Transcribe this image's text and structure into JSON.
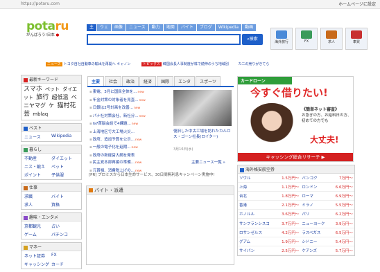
{
  "topbar": {
    "url": "https://potaru.com",
    "home_link": "ホームページに設定"
  },
  "logo": {
    "name_a": "pota",
    "name_b": "ru",
    "tagline": "がんばろう!日本"
  },
  "nav": {
    "tabs": [
      "主",
      "ウェ",
      "画像",
      "ニュース",
      "動力",
      "地図",
      "バイト",
      "ブログ",
      "Wikipedia",
      "動画"
    ],
    "search_button": "検索"
  },
  "quick": [
    "海外旅行",
    "FX",
    "求人",
    "車買"
  ],
  "ticker": {
    "tag1": "ニュース",
    "text1": "トヨタ自社自動車の輸出を再開へ キャノン",
    "tag2": "トピックス",
    "text2": "韓国会長人事制度が株で続伸のうち地域別",
    "text3": "カ二の売りがきてら"
  },
  "left": {
    "hot_header": "最新キーワード",
    "hot_keywords": [
      "スマホ",
      "ペット",
      "ダイエット",
      "旅行",
      "超低温",
      "ベニヤマグ",
      "ケ",
      "猫村花芸",
      "mblaq"
    ],
    "search_header": "ベスト",
    "search_links": [
      "ニュース",
      "Wikipedia"
    ],
    "life_header": "暮らし",
    "life_links": [
      "不動産",
      "ダイエット",
      "ニス・鍛え",
      "ペット",
      "ポイント",
      "子供服"
    ],
    "job_header": "仕事",
    "job_links": [
      "求職",
      "バイト",
      "求人",
      "資格"
    ],
    "hobby_header": "趣味・エンタメ",
    "hobby_links": [
      "京都観光",
      "占い",
      "ゲーム",
      "パチンコ"
    ],
    "money_header": "マネー",
    "money_links": [
      "ネット証券",
      "FX",
      "キャッシング",
      "カード"
    ]
  },
  "main": {
    "tabs": [
      "主要",
      "社会",
      "政治",
      "経済",
      "国際",
      "エンタ",
      "スポーツ"
    ],
    "headlines": [
      "東電、3月に国民全体を...",
      "年金対策の対象者を見直...",
      "日銀は2号計画を改善...",
      "パナ社対策会社、新社分...",
      "G7首脳会談で4課題...",
      "上海地区で大工場火災...",
      "政府、追加予算を公示...",
      "一般の電子化を延期...",
      "政府の新経営大綱を発表",
      "民主党本部再編の準備...",
      "元首相、消費税上げの..."
    ],
    "new_label": "new",
    "photo_caption": "復旧した中古工場を訪れたカルロス・ゴーン社長(ロイター)",
    "photo_date": "3月16日(水)",
    "more_news": "主要ニュース一覧 »"
  },
  "pr": "[PR] プロミスから日本生命サービス、30日間無利息キャンペーン実施中!",
  "baito": {
    "header": "バイト・派遣"
  },
  "ad": {
    "brand": "カードローン",
    "headline": "今すぐ借りたい!",
    "sub": "《簡単ネット審査》",
    "text": "お急ぎの方、お給料日の方、初めての方でも",
    "ok": "大丈夫!",
    "footer": "キャッシング総合リサーチ ▶"
  },
  "fx": {
    "header": "海外格安航空券",
    "rows": [
      [
        "ソウル",
        "1.5万円〜",
        "バンコク",
        "7万円〜"
      ],
      [
        "上海",
        "1.1万円〜",
        "ロンドン",
        "6.6万円〜"
      ],
      [
        "台北",
        "1.8万円〜",
        "ローマ",
        "6.9万円〜"
      ],
      [
        "香港",
        "2.1万円〜",
        "ミラノ",
        "5.5万円〜"
      ],
      [
        "ホノルル",
        "3.6万円〜",
        "パリ",
        "6.2万円〜"
      ],
      [
        "サンフランシスコ",
        "3.7万円〜",
        "ニューヨーク",
        "3.9万円〜"
      ],
      [
        "ロサンゼルス",
        "4.2万円〜",
        "ラスベガス",
        "6.5万円〜"
      ],
      [
        "グアム",
        "1.9万円〜",
        "シドニー",
        "5.4万円〜"
      ],
      [
        "サイパン",
        "2.5万円〜",
        "ケアンズ",
        "5.7万円〜"
      ]
    ]
  }
}
